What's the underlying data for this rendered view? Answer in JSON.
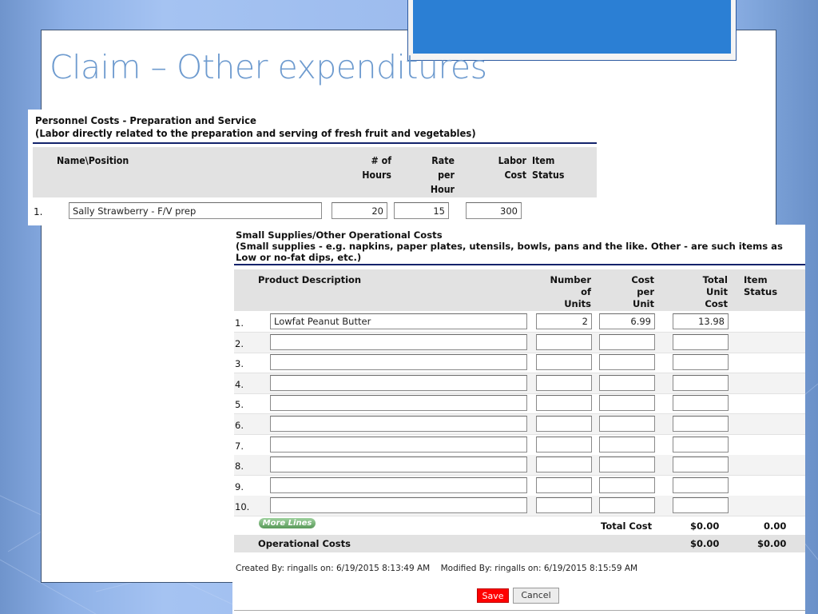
{
  "slide": {
    "title": "Claim – Other expenditures"
  },
  "personnel": {
    "title": "Personnel Costs - Preparation and Service",
    "subtitle": "(Labor directly related to the preparation and serving of fresh fruit and vegetables)",
    "headers": {
      "name": "Name\\Position",
      "hours": "# of\nHours",
      "rate": "Rate\nper\nHour",
      "labor": "Labor\nCost",
      "status": "Item\nStatus"
    },
    "rows": [
      {
        "num": "1.",
        "name": "Sally Strawberry - F/V prep",
        "hours": "20",
        "rate": "15",
        "labor": "300",
        "status": ""
      }
    ]
  },
  "supplies": {
    "title": "Small Supplies/Other Operational Costs",
    "subtitle_line1": "(Small supplies - e.g. napkins, paper plates, utensils, bowls, pans and the like. Other - are such items as",
    "subtitle_line2": "Low or no-fat dips, etc.)",
    "headers": {
      "description": "Product Description",
      "units": "Number\nof\nUnits",
      "cost": "Cost\nper\nUnit",
      "total": "Total\nUnit\nCost",
      "status": "Item\nStatus"
    },
    "rows": [
      {
        "num": "1.",
        "description": "Lowfat Peanut Butter",
        "units": "2",
        "cost": "6.99",
        "total": "13.98"
      },
      {
        "num": "2.",
        "description": "",
        "units": "",
        "cost": "",
        "total": ""
      },
      {
        "num": "3.",
        "description": "",
        "units": "",
        "cost": "",
        "total": ""
      },
      {
        "num": "4.",
        "description": "",
        "units": "",
        "cost": "",
        "total": ""
      },
      {
        "num": "5.",
        "description": "",
        "units": "",
        "cost": "",
        "total": ""
      },
      {
        "num": "6.",
        "description": "",
        "units": "",
        "cost": "",
        "total": ""
      },
      {
        "num": "7.",
        "description": "",
        "units": "",
        "cost": "",
        "total": ""
      },
      {
        "num": "8.",
        "description": "",
        "units": "",
        "cost": "",
        "total": ""
      },
      {
        "num": "9.",
        "description": "",
        "units": "",
        "cost": "",
        "total": ""
      },
      {
        "num": "10.",
        "description": "",
        "units": "",
        "cost": "",
        "total": ""
      }
    ],
    "more_lines_label": "More Lines",
    "total_cost_label": "Total Cost",
    "total_cost_value": "$0.00",
    "total_cost_status": "0.00",
    "operational_costs_label": "Operational Costs",
    "operational_costs_value": "$0.00",
    "operational_costs_status": "$0.00",
    "created_by": "Created By: ringalls on: 6/19/2015 8:13:49 AM",
    "modified_by": "Modified By: ringalls on: 6/19/2015 8:15:59 AM",
    "save_label": "Save",
    "cancel_label": "Cancel"
  },
  "colors": {
    "title": "#6e9bcf",
    "rule": "#13236b",
    "header_bg": "#e2e2e2",
    "save": "#ff0000",
    "more_lines": "#6aa86a"
  }
}
